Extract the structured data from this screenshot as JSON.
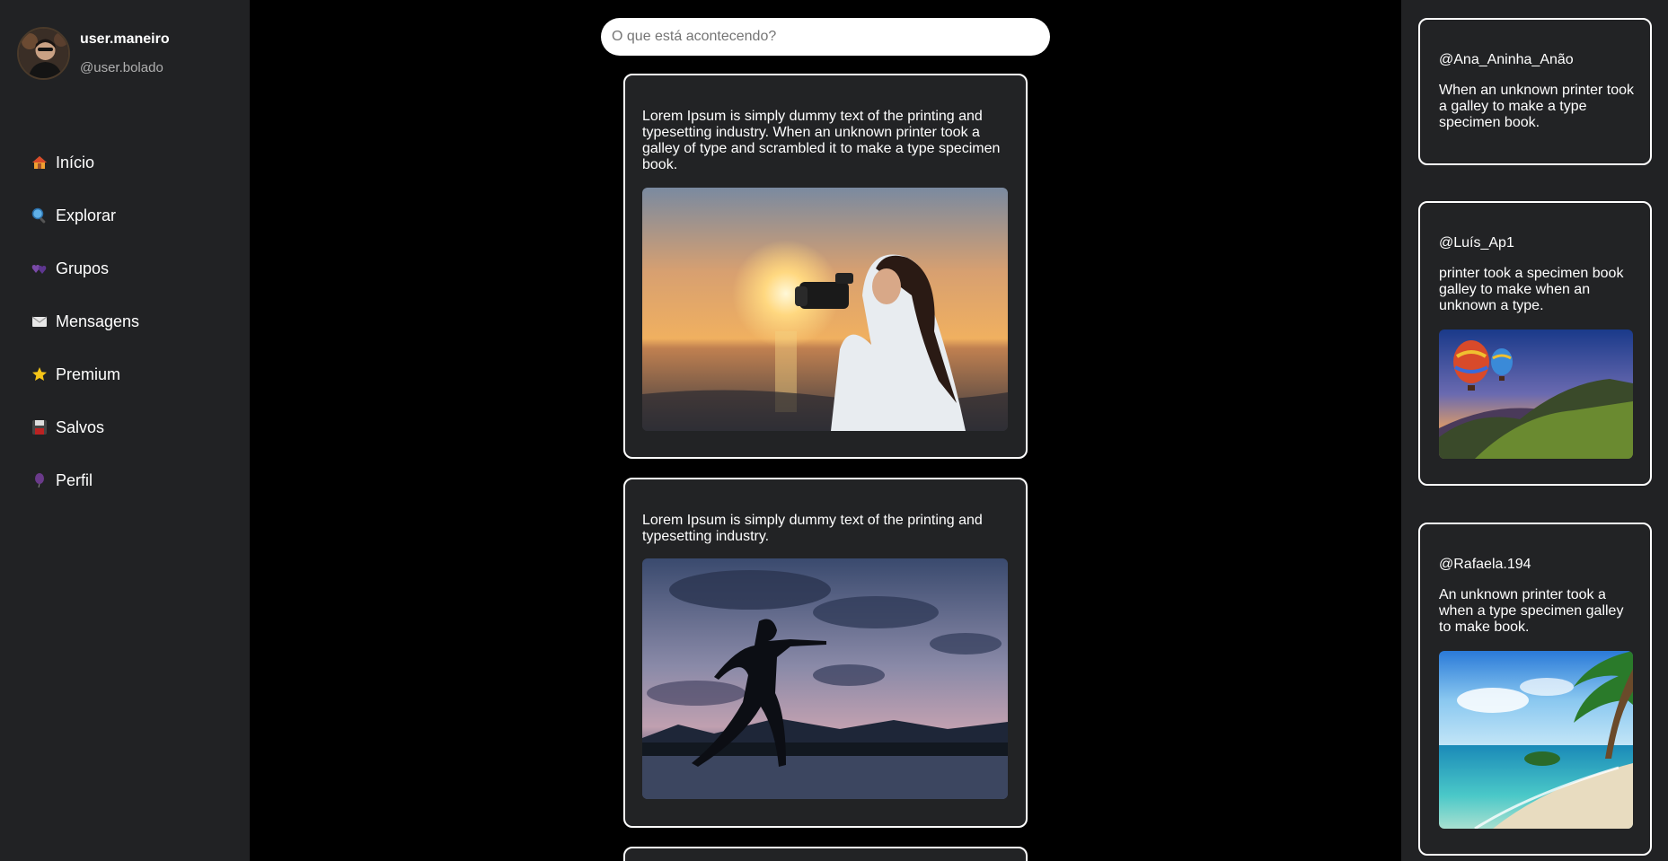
{
  "profile": {
    "name": "user.maneiro",
    "handle": "@user.bolado"
  },
  "nav": [
    {
      "label": "Início",
      "icon": "house-icon"
    },
    {
      "label": "Explorar",
      "icon": "magnifier-icon"
    },
    {
      "label": "Grupos",
      "icon": "hearts-icon"
    },
    {
      "label": "Mensagens",
      "icon": "envelope-icon"
    },
    {
      "label": "Premium",
      "icon": "star-icon"
    },
    {
      "label": "Salvos",
      "icon": "floppy-disk-icon"
    },
    {
      "label": "Perfil",
      "icon": "balloon-icon"
    }
  ],
  "search": {
    "placeholder": "O que está acontecendo?"
  },
  "posts": [
    {
      "text": "Lorem Ipsum is simply dummy text of the printing and typesetting industry. When an unknown printer took a galley of type and scrambled it to make a type specimen book."
    },
    {
      "text": "Lorem Ipsum is simply dummy text of the printing and typesetting industry."
    }
  ],
  "side_cards": [
    {
      "handle": "@Ana_Aninha_Anão",
      "text": "When an unknown printer took a galley to make a type specimen book."
    },
    {
      "handle": "@Luís_Ap1",
      "text": "printer took a specimen book galley to make when an unknown a type."
    },
    {
      "handle": "@Rafaela.194",
      "text": "An unknown printer took a when a type specimen galley to make book."
    }
  ],
  "colors": {
    "background": "#000000",
    "panel": "#212224",
    "card": "#222325",
    "border": "#ffffff"
  }
}
